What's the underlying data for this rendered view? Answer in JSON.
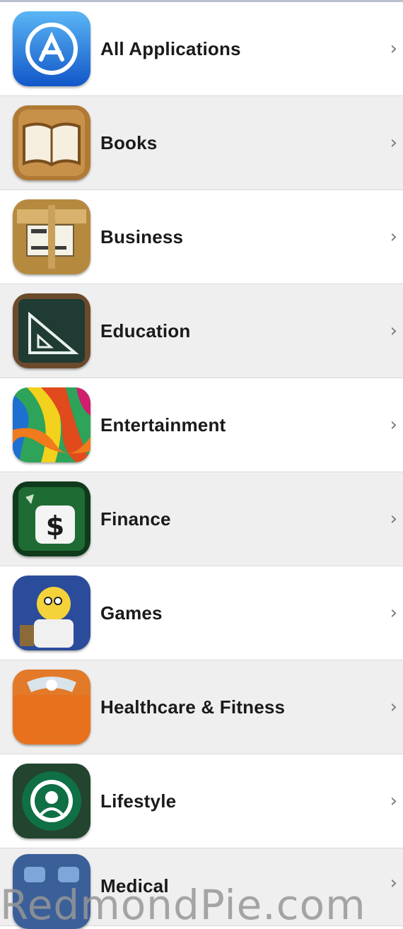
{
  "categories": [
    {
      "label": "All Applications",
      "icon": "app-store-icon"
    },
    {
      "label": "Books",
      "icon": "books-icon"
    },
    {
      "label": "Business",
      "icon": "business-icon"
    },
    {
      "label": "Education",
      "icon": "education-icon"
    },
    {
      "label": "Entertainment",
      "icon": "entertainment-icon"
    },
    {
      "label": "Finance",
      "icon": "finance-icon"
    },
    {
      "label": "Games",
      "icon": "games-icon"
    },
    {
      "label": "Healthcare & Fitness",
      "icon": "healthcare-fitness-icon"
    },
    {
      "label": "Lifestyle",
      "icon": "lifestyle-icon"
    },
    {
      "label": "Medical",
      "icon": "medical-icon"
    }
  ],
  "chevron": "›",
  "watermark": "RedmondPie.com"
}
